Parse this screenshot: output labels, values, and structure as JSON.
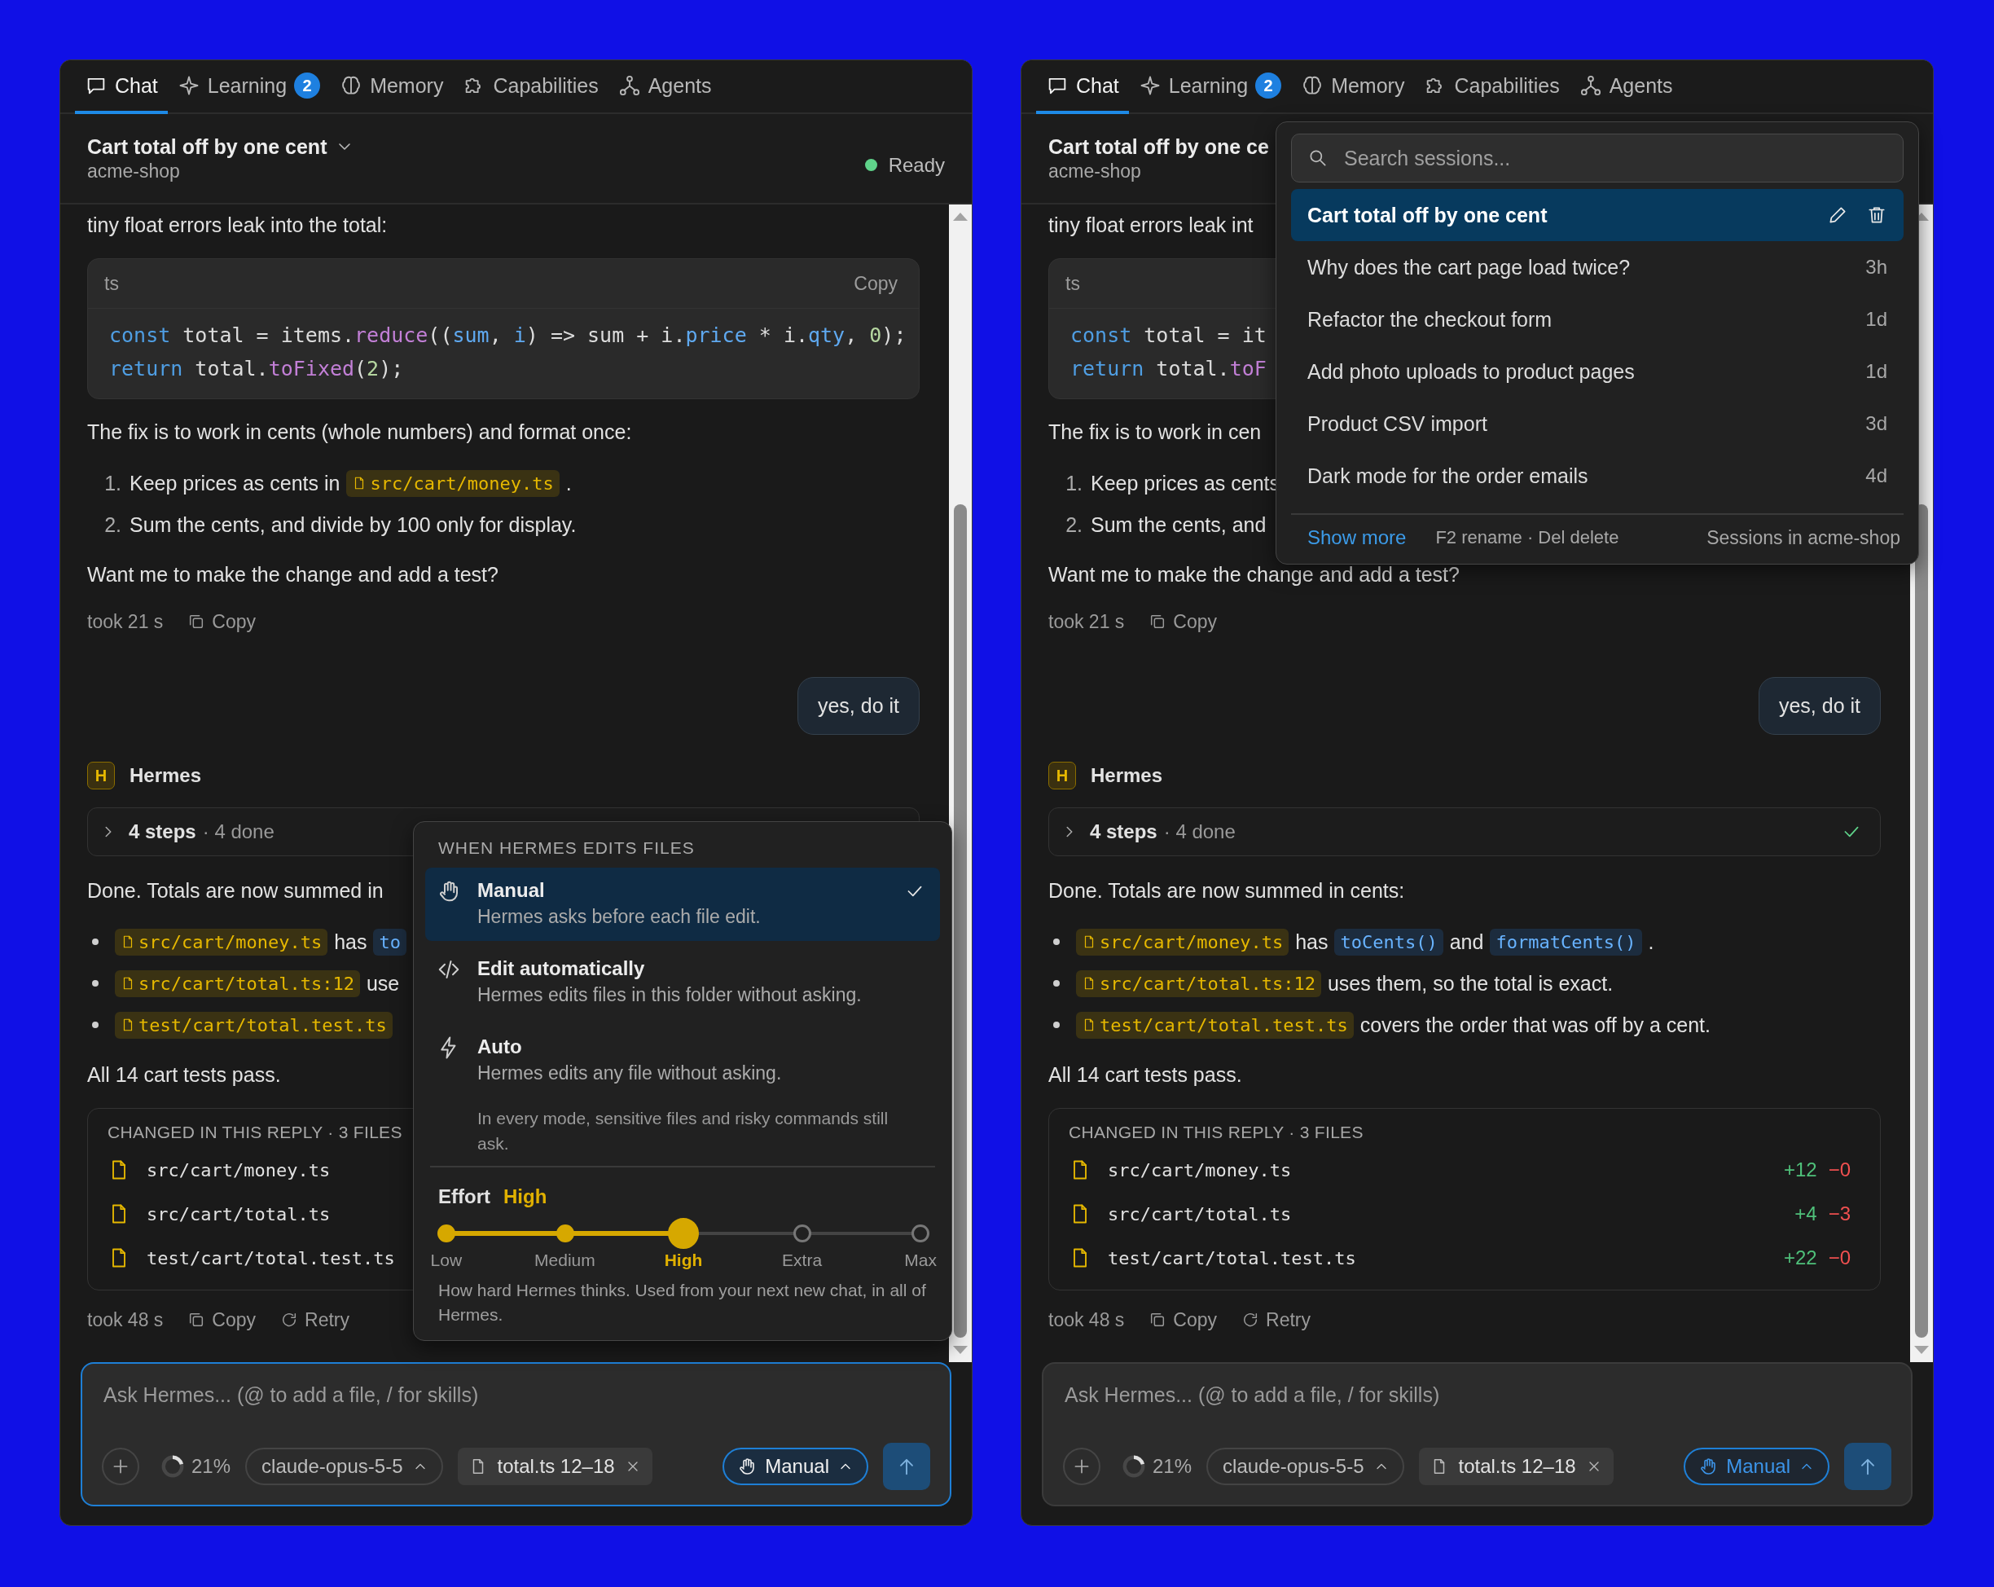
{
  "panels": [
    {
      "tabs": [
        {
          "label": "Chat",
          "selected": true
        },
        {
          "label": "Learning",
          "selected": false,
          "badge": "2"
        },
        {
          "label": "Memory",
          "selected": false
        },
        {
          "label": "Capabilities",
          "selected": false
        },
        {
          "label": "Agents",
          "selected": false
        }
      ],
      "header": {
        "title": "Cart total off by one cent",
        "project": "acme-shop",
        "status": "Ready"
      },
      "messages": [
        {
          "kind": "text",
          "text": "tiny float errors leak into the total:"
        },
        {
          "kind": "code",
          "lang": "ts",
          "copy": "Copy",
          "lines": [
            [
              {
                "kind": "keyword",
                "text": "const"
              },
              {
                "kind": "plain",
                "text": " total = items."
              },
              {
                "kind": "function",
                "text": "reduce"
              },
              {
                "kind": "plain",
                "text": "(("
              },
              {
                "kind": "variable",
                "text": "sum"
              },
              {
                "kind": "plain",
                "text": ", "
              },
              {
                "kind": "variable",
                "text": "i"
              },
              {
                "kind": "plain",
                "text": ") => sum + i."
              },
              {
                "kind": "variable",
                "text": "price"
              },
              {
                "kind": "plain",
                "text": " * i."
              },
              {
                "kind": "variable",
                "text": "qty"
              },
              {
                "kind": "plain",
                "text": ", "
              },
              {
                "kind": "number",
                "text": "0"
              },
              {
                "kind": "plain",
                "text": ");"
              }
            ],
            [
              {
                "kind": "keyword",
                "text": "return"
              },
              {
                "kind": "plain",
                "text": " total."
              },
              {
                "kind": "function",
                "text": "toFixed"
              },
              {
                "kind": "plain",
                "text": "("
              },
              {
                "kind": "number",
                "text": "2"
              },
              {
                "kind": "plain",
                "text": ");"
              }
            ]
          ]
        },
        {
          "kind": "text",
          "text": "The fix is to work in cents (whole numbers) and format once:"
        },
        {
          "kind": "numbered",
          "items": [
            {
              "number": "1.",
              "parts": [
                {
                  "kind": "text",
                  "text": "Keep prices as cents in"
                },
                {
                  "kind": "file",
                  "text": "src/cart/money.ts"
                },
                {
                  "kind": "text",
                  "text": "."
                }
              ]
            },
            {
              "number": "2.",
              "parts": [
                {
                  "kind": "text",
                  "text": "Sum the cents, and divide by 100 only for display."
                }
              ]
            }
          ]
        },
        {
          "kind": "text",
          "text": "Want me to make the change and add a test?"
        },
        {
          "kind": "meta",
          "took": "took 21 s",
          "actions": [
            {
              "kind": "copy",
              "label": "Copy"
            }
          ]
        },
        {
          "kind": "user",
          "text": "yes, do it"
        },
        {
          "kind": "agent",
          "avatar": "H",
          "name": "Hermes"
        },
        {
          "kind": "steps",
          "label": "4 steps",
          "detail": "· 4 done"
        },
        {
          "kind": "text",
          "text": "Done. Totals are now summed in"
        },
        {
          "kind": "bullets",
          "items": [
            {
              "parts": [
                {
                  "kind": "file",
                  "text": "src/cart/money.ts"
                },
                {
                  "kind": "text",
                  "text": "has"
                },
                {
                  "kind": "symbol",
                  "text": "to"
                }
              ]
            },
            {
              "parts": [
                {
                  "kind": "file",
                  "text": "src/cart/total.ts:12"
                },
                {
                  "kind": "text",
                  "text": "use"
                }
              ]
            },
            {
              "parts": [
                {
                  "kind": "file",
                  "text": "test/cart/total.test.ts"
                }
              ]
            }
          ]
        },
        {
          "kind": "text",
          "text": "All 14 cart tests pass."
        },
        {
          "kind": "changes",
          "title": "CHANGED IN THIS REPLY · 3 FILES",
          "files": [
            {
              "path": "src/cart/money.ts"
            },
            {
              "path": "src/cart/total.ts"
            },
            {
              "path": "test/cart/total.test.ts"
            }
          ]
        },
        {
          "kind": "meta",
          "took": "took 48 s",
          "actions": [
            {
              "kind": "copy",
              "label": "Copy"
            },
            {
              "kind": "retry",
              "label": "Retry"
            }
          ]
        }
      ],
      "composer": {
        "placeholder": "Ask Hermes... (@ to add a file, / for skills)",
        "focused": true,
        "context": {
          "level": 0.21,
          "reading": "21%"
        },
        "model": "claude-opus-5-5",
        "attachment": "total.ts 12–18",
        "mode": {
          "label": "Manual",
          "open": true
        }
      },
      "mode_menu": {
        "title": "WHEN HERMES EDITS FILES",
        "options": [
          {
            "kind": "manual",
            "label": "Manual",
            "description": "Hermes asks before each file edit.",
            "selected": true
          },
          {
            "kind": "automatic",
            "label": "Edit automatically",
            "description": "Hermes edits files in this folder without asking.",
            "selected": false
          },
          {
            "kind": "auto",
            "label": "Auto",
            "description": "Hermes edits any file without asking.",
            "selected": false
          }
        ],
        "note": "In every mode, sensitive files and risky commands still ask.",
        "effort": {
          "label": "Effort",
          "value": "High",
          "level": 0.5,
          "stops": [
            {
              "label": "Low",
              "selected": false
            },
            {
              "label": "Medium",
              "selected": false
            },
            {
              "label": "High",
              "selected": true
            },
            {
              "label": "Extra",
              "selected": false
            },
            {
              "label": "Max",
              "selected": false
            }
          ]
        },
        "hint": "How hard Hermes thinks. Used from your next new chat, in all of Hermes."
      }
    },
    {
      "tabs": [
        {
          "label": "Chat",
          "selected": true
        },
        {
          "label": "Learning",
          "selected": false,
          "badge": "2"
        },
        {
          "label": "Memory",
          "selected": false
        },
        {
          "label": "Capabilities",
          "selected": false
        },
        {
          "label": "Agents",
          "selected": false
        }
      ],
      "header": {
        "title": "Cart total off by one ce",
        "project": "acme-shop"
      },
      "messages": [
        {
          "kind": "text",
          "text": "tiny float errors leak int"
        },
        {
          "kind": "code",
          "lang": "ts",
          "lines": [
            [
              {
                "kind": "keyword",
                "text": "const"
              },
              {
                "kind": "plain",
                "text": " total = it"
              }
            ],
            [
              {
                "kind": "keyword",
                "text": "return"
              },
              {
                "kind": "plain",
                "text": " total."
              },
              {
                "kind": "function",
                "text": "toF"
              }
            ]
          ]
        },
        {
          "kind": "text",
          "text": "The fix is to work in cen"
        },
        {
          "kind": "numbered",
          "items": [
            {
              "number": "1.",
              "parts": [
                {
                  "kind": "text",
                  "text": "Keep prices as cents"
                }
              ]
            },
            {
              "number": "2.",
              "parts": [
                {
                  "kind": "text",
                  "text": "Sum the cents, and"
                }
              ]
            }
          ]
        },
        {
          "kind": "text",
          "text": "Want me to make the change and add a test?"
        },
        {
          "kind": "meta",
          "took": "took 21 s",
          "actions": [
            {
              "kind": "copy",
              "label": "Copy"
            }
          ]
        },
        {
          "kind": "user",
          "text": "yes, do it"
        },
        {
          "kind": "agent",
          "avatar": "H",
          "name": "Hermes"
        },
        {
          "kind": "steps",
          "label": "4 steps",
          "detail": "· 4 done",
          "done": true
        },
        {
          "kind": "text",
          "text": "Done. Totals are now summed in cents:"
        },
        {
          "kind": "bullets",
          "items": [
            {
              "parts": [
                {
                  "kind": "file",
                  "text": "src/cart/money.ts"
                },
                {
                  "kind": "text",
                  "text": "has"
                },
                {
                  "kind": "symbol",
                  "text": "toCents()"
                },
                {
                  "kind": "text",
                  "text": "and"
                },
                {
                  "kind": "symbol",
                  "text": "formatCents()"
                },
                {
                  "kind": "text",
                  "text": "."
                }
              ]
            },
            {
              "parts": [
                {
                  "kind": "file",
                  "text": "src/cart/total.ts:12"
                },
                {
                  "kind": "text",
                  "text": "uses them, so the total is exact."
                }
              ]
            },
            {
              "parts": [
                {
                  "kind": "file",
                  "text": "test/cart/total.test.ts"
                },
                {
                  "kind": "text",
                  "text": "covers the order that was off by a cent."
                }
              ]
            }
          ]
        },
        {
          "kind": "text",
          "text": "All 14 cart tests pass."
        },
        {
          "kind": "changes",
          "title": "CHANGED IN THIS REPLY · 3 FILES",
          "files": [
            {
              "path": "src/cart/money.ts",
              "added": "+12",
              "removed": "−0"
            },
            {
              "path": "src/cart/total.ts",
              "added": "+4",
              "removed": "−3"
            },
            {
              "path": "test/cart/total.test.ts",
              "added": "+22",
              "removed": "−0"
            }
          ]
        },
        {
          "kind": "meta",
          "took": "took 48 s",
          "actions": [
            {
              "kind": "copy",
              "label": "Copy"
            },
            {
              "kind": "retry",
              "label": "Retry"
            }
          ]
        }
      ],
      "composer": {
        "placeholder": "Ask Hermes... (@ to add a file, / for skills)",
        "focused": false,
        "context": {
          "level": 0.21,
          "reading": "21%"
        },
        "model": "claude-opus-5-5",
        "attachment": "total.ts 12–18",
        "mode": {
          "label": "Manual",
          "open": false
        }
      },
      "session_menu": {
        "placeholder": "Search sessions...",
        "sessions": [
          {
            "title": "Cart total off by one cent",
            "selected": true
          },
          {
            "title": "Why does the cart page load twice?",
            "age": "3h",
            "selected": false
          },
          {
            "title": "Refactor the checkout form",
            "age": "1d",
            "selected": false
          },
          {
            "title": "Add photo uploads to product pages",
            "age": "1d",
            "selected": false
          },
          {
            "title": "Product CSV import",
            "age": "3d",
            "selected": false
          },
          {
            "title": "Dark mode for the order emails",
            "age": "4d",
            "selected": false
          }
        ],
        "show_more": "Show more",
        "hint": "F2 rename · Del delete",
        "scope": "Sessions in acme-shop"
      }
    }
  ]
}
